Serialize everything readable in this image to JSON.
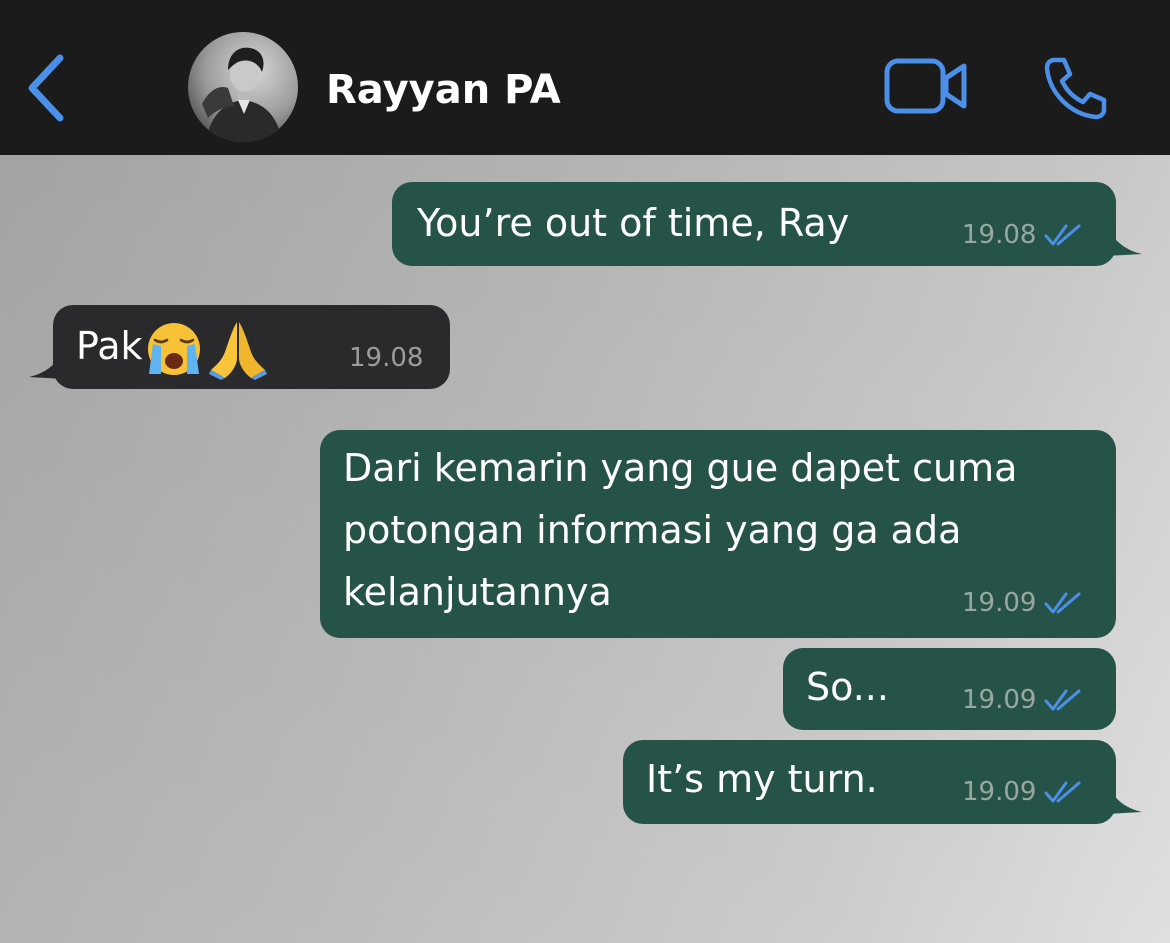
{
  "header": {
    "contact_name": "Rayyan PA",
    "back_icon": "chevron-left-icon",
    "video_icon": "video-camera-icon",
    "phone_icon": "phone-icon"
  },
  "messages": [
    {
      "direction": "outgoing",
      "text": "You’re out of time, Ray",
      "time": "19.08",
      "status": "read"
    },
    {
      "direction": "incoming",
      "text": "Pak",
      "emojis": [
        "loudly-crying-face",
        "folded-hands"
      ],
      "time": "19.08"
    },
    {
      "direction": "outgoing",
      "lines": [
        "Dari kemarin yang gue dapet cuma",
        "potongan informasi yang ga ada",
        "kelanjutannya"
      ],
      "time": "19.09",
      "status": "read"
    },
    {
      "direction": "outgoing",
      "text": "So...",
      "time": "19.09",
      "status": "read"
    },
    {
      "direction": "outgoing",
      "text": "It’s my turn.",
      "time": "19.09",
      "status": "read"
    }
  ],
  "colors": {
    "header_bg": "#1b1b1b",
    "accent_blue": "#4a8fe8",
    "outgoing_bubble": "#265347",
    "incoming_bubble": "#2a2a2c",
    "read_tick": "#4a8fe8"
  }
}
